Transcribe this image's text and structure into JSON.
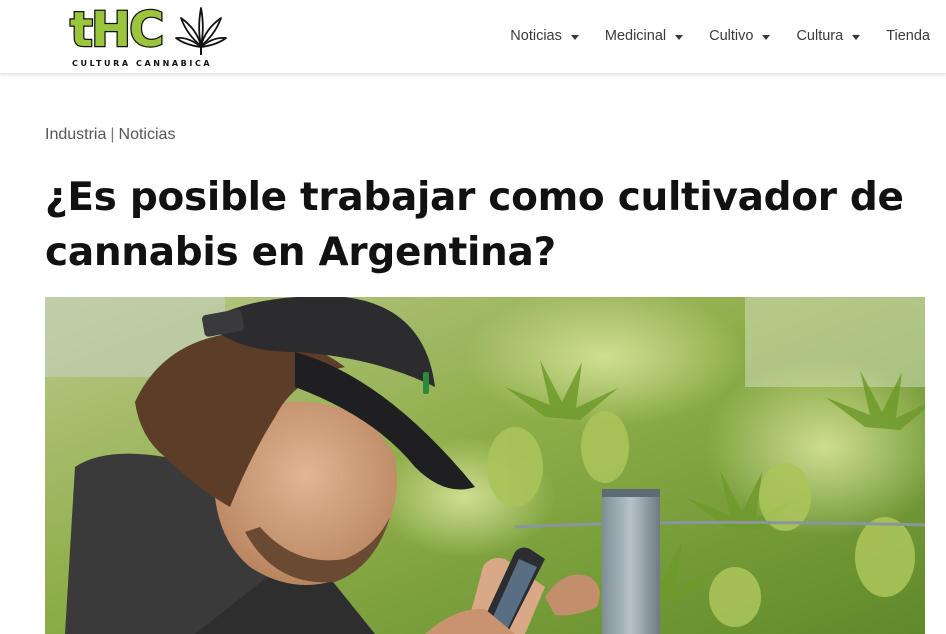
{
  "brand": {
    "wordmark": "tHC",
    "tagline": "CULTURA CANNABICA",
    "colors": {
      "green": "#9bc53d",
      "outline": "#111111"
    }
  },
  "nav": {
    "items": [
      {
        "label": "Noticias",
        "dropdown": true
      },
      {
        "label": "Medicinal",
        "dropdown": true
      },
      {
        "label": "Cultivo",
        "dropdown": true
      },
      {
        "label": "Cultura",
        "dropdown": true
      },
      {
        "label": "Tienda",
        "dropdown": false
      }
    ]
  },
  "article": {
    "categories": [
      "Industria",
      "Noticias"
    ],
    "category_separator": "|",
    "title": "¿Es posible trabajar como cultivador de cannabis en Argentina?"
  },
  "hero_image": {
    "subject": "man-in-cap-checking-phone-among-cannabis-plants"
  }
}
